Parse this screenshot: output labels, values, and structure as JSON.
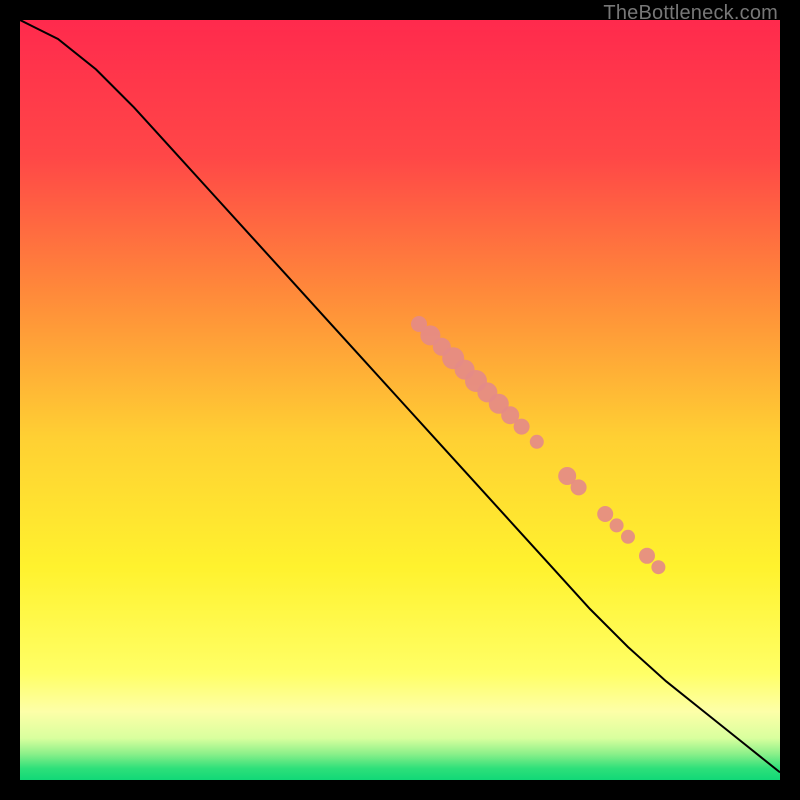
{
  "watermark": "TheBottleneck.com",
  "chart_data": {
    "type": "line",
    "title": "",
    "xlabel": "",
    "ylabel": "",
    "xlim": [
      0,
      100
    ],
    "ylim": [
      0,
      100
    ],
    "grid": false,
    "background_gradient": {
      "stops": [
        {
          "offset": 0.0,
          "color": "#ff2a4d"
        },
        {
          "offset": 0.18,
          "color": "#ff4747"
        },
        {
          "offset": 0.36,
          "color": "#ff8a3a"
        },
        {
          "offset": 0.55,
          "color": "#ffd033"
        },
        {
          "offset": 0.72,
          "color": "#fff22e"
        },
        {
          "offset": 0.86,
          "color": "#ffff66"
        },
        {
          "offset": 0.91,
          "color": "#fdffa8"
        },
        {
          "offset": 0.945,
          "color": "#d9ff9e"
        },
        {
          "offset": 0.965,
          "color": "#8ef08a"
        },
        {
          "offset": 0.985,
          "color": "#2de07a"
        },
        {
          "offset": 1.0,
          "color": "#11d877"
        }
      ]
    },
    "series": [
      {
        "name": "curve",
        "type": "line",
        "color": "#000000",
        "x": [
          0,
          2,
          5,
          10,
          15,
          20,
          25,
          30,
          35,
          40,
          45,
          50,
          55,
          60,
          65,
          70,
          75,
          80,
          85,
          90,
          95,
          100
        ],
        "y": [
          100,
          99,
          97.5,
          93.5,
          88.5,
          83,
          77.5,
          72,
          66.5,
          61,
          55.5,
          50,
          44.5,
          39,
          33.5,
          28,
          22.5,
          17.5,
          13,
          9,
          5,
          1
        ]
      },
      {
        "name": "cluster-points",
        "type": "scatter",
        "color": "#e58b87",
        "radius_default": 8,
        "points": [
          {
            "x": 52.5,
            "y": 60.0,
            "r": 8
          },
          {
            "x": 54.0,
            "y": 58.5,
            "r": 10
          },
          {
            "x": 55.5,
            "y": 57.0,
            "r": 9
          },
          {
            "x": 57.0,
            "y": 55.5,
            "r": 11
          },
          {
            "x": 58.5,
            "y": 54.0,
            "r": 10
          },
          {
            "x": 60.0,
            "y": 52.5,
            "r": 11
          },
          {
            "x": 61.5,
            "y": 51.0,
            "r": 10
          },
          {
            "x": 63.0,
            "y": 49.5,
            "r": 10
          },
          {
            "x": 64.5,
            "y": 48.0,
            "r": 9
          },
          {
            "x": 66.0,
            "y": 46.5,
            "r": 8
          },
          {
            "x": 68.0,
            "y": 44.5,
            "r": 7
          },
          {
            "x": 72.0,
            "y": 40.0,
            "r": 9
          },
          {
            "x": 73.5,
            "y": 38.5,
            "r": 8
          },
          {
            "x": 77.0,
            "y": 35.0,
            "r": 8
          },
          {
            "x": 78.5,
            "y": 33.5,
            "r": 7
          },
          {
            "x": 80.0,
            "y": 32.0,
            "r": 7
          },
          {
            "x": 82.5,
            "y": 29.5,
            "r": 8
          },
          {
            "x": 84.0,
            "y": 28.0,
            "r": 7
          }
        ]
      }
    ]
  }
}
